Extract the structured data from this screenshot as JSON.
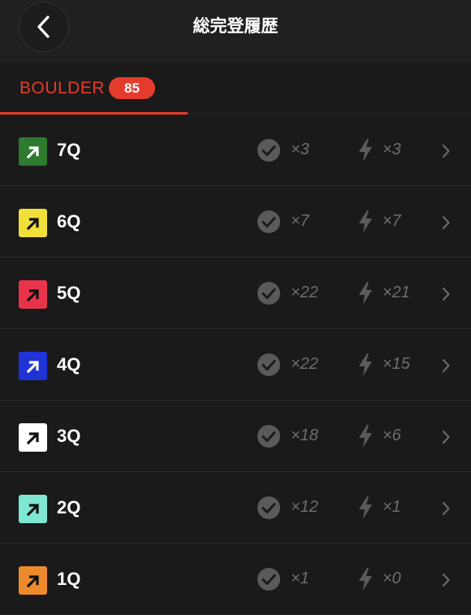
{
  "header": {
    "title": "総完登履歴"
  },
  "tab": {
    "label": "BOULDER",
    "count": "85",
    "accent": "#e53b2c"
  },
  "rows": [
    {
      "grade": "7Q",
      "color": "#2e7a2e",
      "arrow": "#ffffff",
      "sends": "×3",
      "flashes": "×3"
    },
    {
      "grade": "6Q",
      "color": "#f2e03a",
      "arrow": "#111111",
      "sends": "×7",
      "flashes": "×7"
    },
    {
      "grade": "5Q",
      "color": "#e8344a",
      "arrow": "#111111",
      "sends": "×22",
      "flashes": "×21"
    },
    {
      "grade": "4Q",
      "color": "#1f33d6",
      "arrow": "#ffffff",
      "sends": "×22",
      "flashes": "×15"
    },
    {
      "grade": "3Q",
      "color": "#ffffff",
      "arrow": "#111111",
      "sends": "×18",
      "flashes": "×6"
    },
    {
      "grade": "2Q",
      "color": "#7fe6d2",
      "arrow": "#111111",
      "sends": "×12",
      "flashes": "×1"
    },
    {
      "grade": "1Q",
      "color": "#ee8a2e",
      "arrow": "#111111",
      "sends": "×1",
      "flashes": "×0"
    }
  ],
  "icons": {
    "back": "chevron-left-icon",
    "grade": "arrow-up-right-icon",
    "send": "check-circle-icon",
    "flash": "lightning-icon",
    "row_nav": "chevron-right-icon"
  }
}
